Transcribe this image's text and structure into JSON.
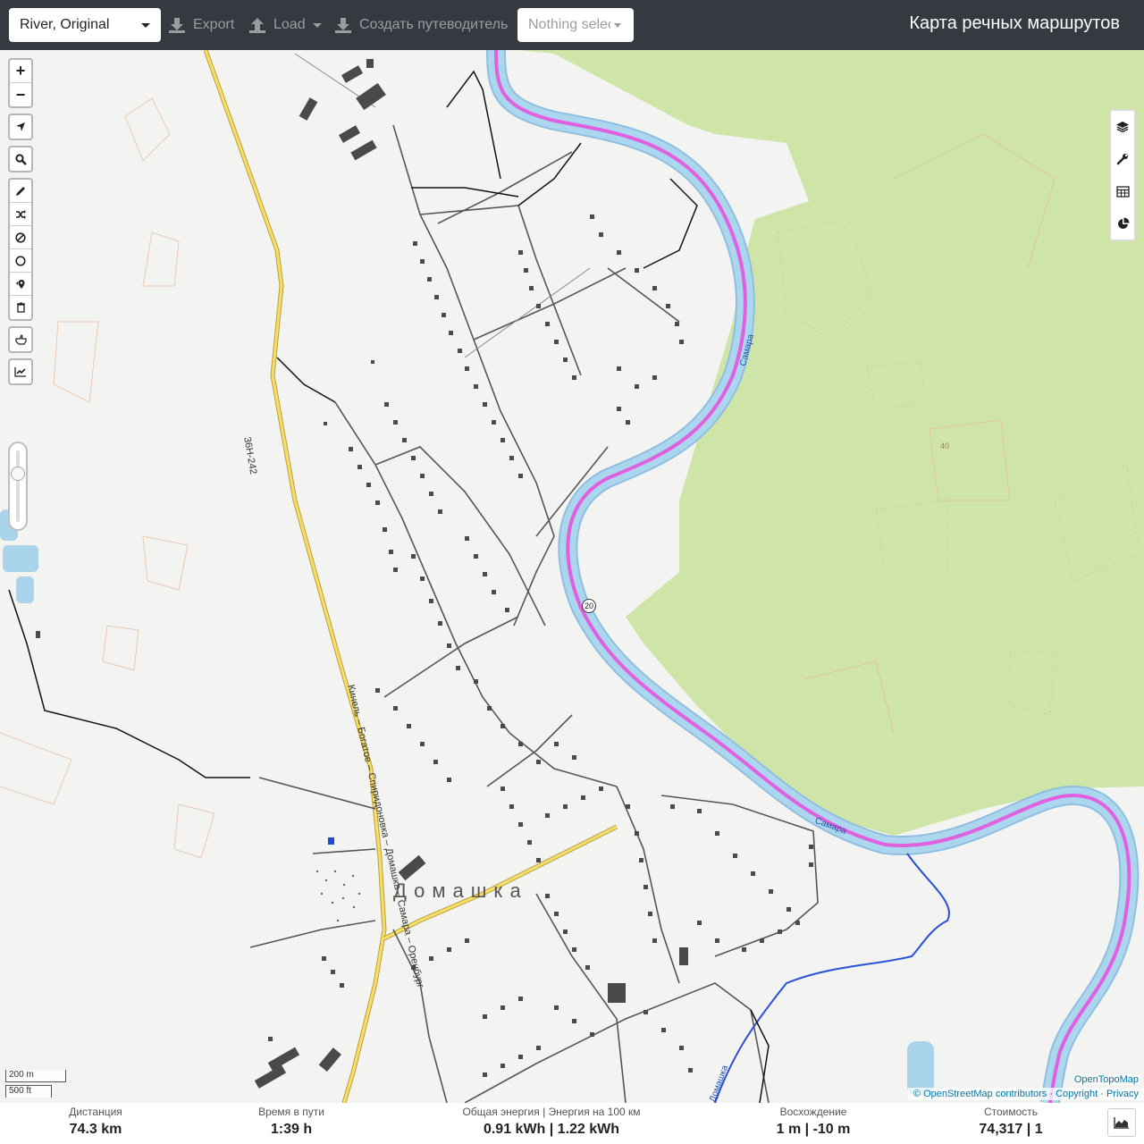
{
  "navbar": {
    "profile": "River, Original",
    "export_label": "Export",
    "load_label": "Load",
    "guide_label": "Создать путеводитель",
    "nothing_selected": "Nothing selected",
    "brand": "Карта речных маршрутов"
  },
  "map": {
    "road_number": "36Н-242",
    "road_name": "Кинель – Богатое – Спиридоновка – Домашка – Самара – Оренбург",
    "village_label": "Домашка",
    "river_label_1": "Самара",
    "river_label_2": "Самара",
    "stream_label": "Домашка",
    "route_marker": "20",
    "contour_label": "40"
  },
  "scale": {
    "metric": "200 m",
    "imperial": "500 ft"
  },
  "attribution": {
    "otm": "OpenTopoMap",
    "osm": "© OpenStreetMap contributors",
    "copyright": "Copyright",
    "privacy": "Privacy",
    "sep": " · "
  },
  "stats": {
    "distance_label": "Дистанция",
    "distance_value": "74.3 km",
    "time_label": "Время в пути",
    "time_value": "1:39 h",
    "energy_label": "Общая энергия | Энергия на 100 км",
    "energy_value": "0.91 kWh | 1.22 kWh",
    "ascent_label": "Восхождение",
    "ascent_value": "1 m | -10 m",
    "cost_label": "Стоимость",
    "cost_value": "74,317 | 1"
  },
  "colors": {
    "navbar": "#343a40",
    "forest": "#cbe3a4",
    "river": "#a9d3e8",
    "route": "#e060e0",
    "highway": "#f7de6a"
  }
}
